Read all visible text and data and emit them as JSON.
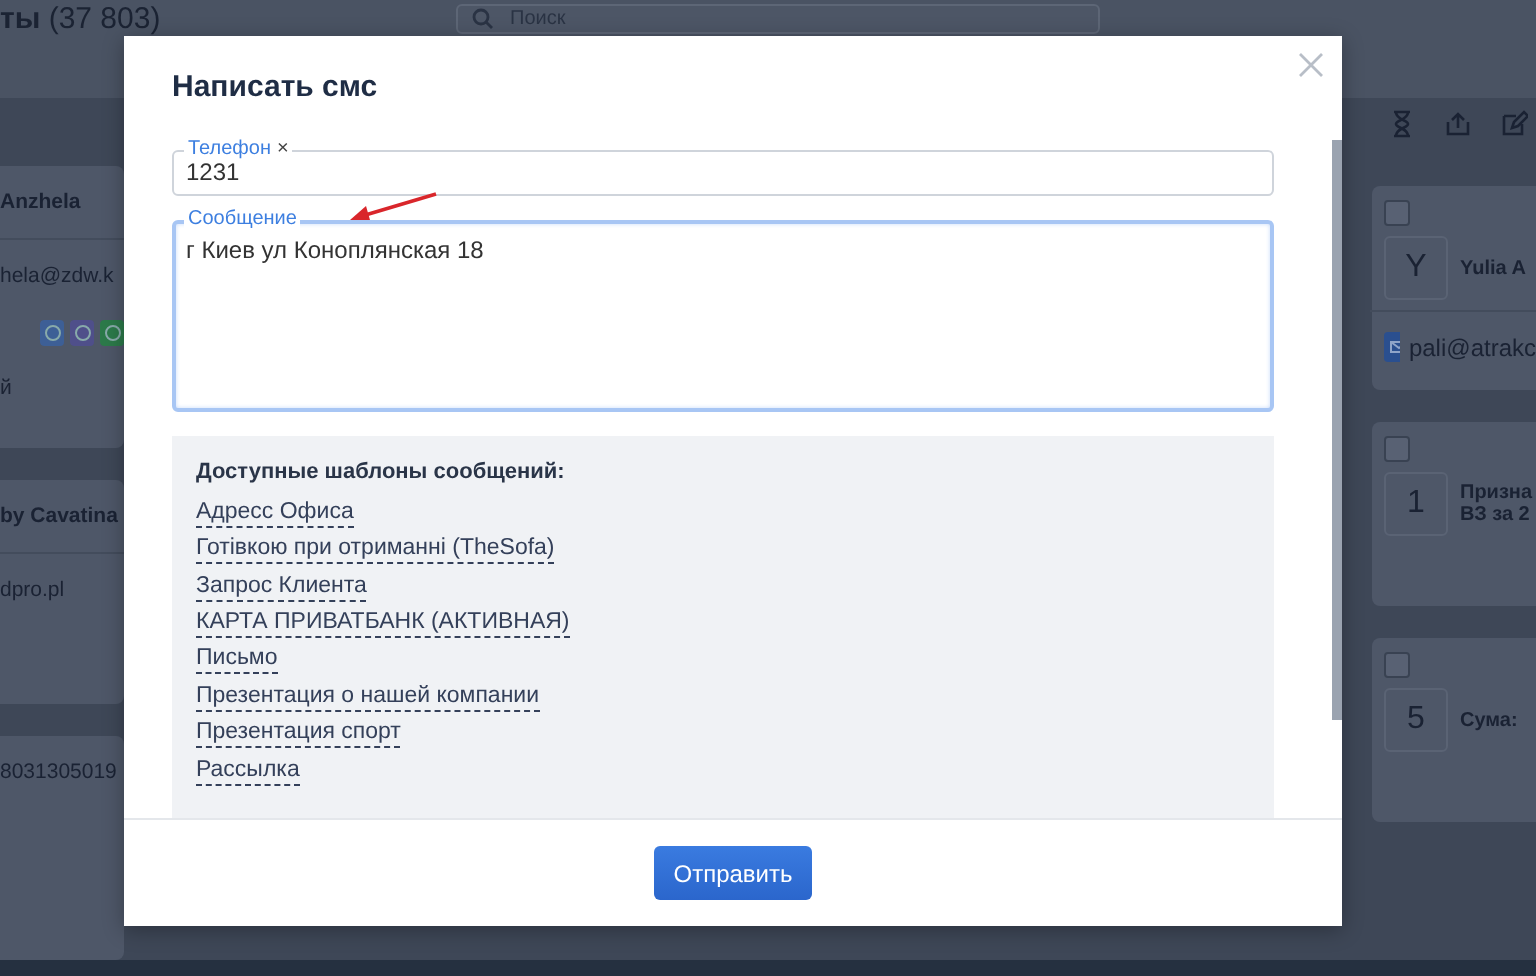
{
  "background": {
    "title": "**ты** (37 803)",
    "search": {
      "placeholder": "Поиск"
    },
    "left_cards": [
      {
        "lines": [
          {
            "kind": "name",
            "text": "Anzhela"
          },
          {
            "kind": "email",
            "text": "hela@zdw.k"
          },
          {
            "kind": "contacts"
          },
          {
            "kind": "text",
            "text": "й"
          }
        ]
      },
      {
        "lines": [
          {
            "kind": "name",
            "text": "by Cavatina"
          },
          {
            "kind": "text",
            "text": "dpro.pl"
          }
        ]
      },
      {
        "lines": [
          {
            "kind": "text",
            "text": "8031305019"
          }
        ]
      }
    ],
    "right_cards": [
      {
        "checked": false,
        "badge": "Y",
        "lines": [
          "Yulia A"
        ],
        "email": "pali@atrakc"
      },
      {
        "checked": false,
        "badge": "1",
        "lines": [
          "Призна",
          "ВЗ за 2"
        ]
      },
      {
        "checked": false,
        "badge": "5",
        "lines": [
          "Сума:"
        ]
      }
    ]
  },
  "dialog": {
    "title": "Написать смс",
    "fields": [
      {
        "kind": "input",
        "label": "Телефон",
        "clear": "×",
        "value": "1231",
        "focused": false
      },
      {
        "kind": "textarea",
        "label": "Сообщение",
        "value": "г Киев ул Коноплянская 18",
        "focused": true
      }
    ],
    "templates": {
      "heading": "Доступные шаблоны сообщений:",
      "items": [
        "Адресс Офиса",
        "Готівкою при отриманні (TheSofa)",
        "Запрос Клиента",
        "КАРТА ПРИВАТБАНК (АКТИВНАЯ)",
        "Письмо",
        "Презентация о нашей компании",
        "Презентация спорт",
        "Рассылка"
      ]
    },
    "submit": "Отправить"
  }
}
